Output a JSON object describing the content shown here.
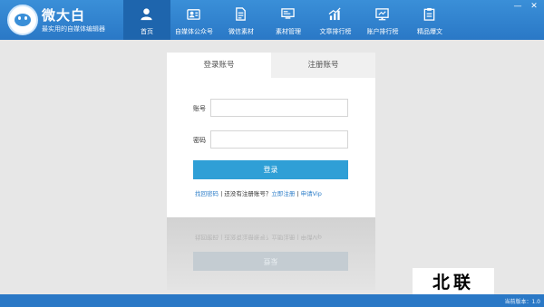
{
  "app": {
    "title": "微大白",
    "subtitle": "最实用的自媒体编辑器"
  },
  "nav": {
    "items": [
      {
        "label": "首页",
        "icon": "user-icon"
      },
      {
        "label": "自媒体公众号",
        "icon": "media-account-icon"
      },
      {
        "label": "微信素材",
        "icon": "document-icon"
      },
      {
        "label": "素材管理",
        "icon": "monitor-icon"
      },
      {
        "label": "文章排行榜",
        "icon": "chart-icon"
      },
      {
        "label": "账户排行榜",
        "icon": "screen-icon"
      },
      {
        "label": "精品爆文",
        "icon": "clipboard-icon"
      }
    ]
  },
  "window": {
    "minimize": "—",
    "close": "✕"
  },
  "login": {
    "tab_login": "登录账号",
    "tab_register": "注册账号",
    "account_label": "账号",
    "password_label": "密码",
    "account_value": "",
    "password_value": "",
    "login_button": "登录",
    "link_forgot": "找回密码",
    "sep1": " | ",
    "text_no_account": "还没有注册账号？",
    "link_register": "立即注册",
    "sep2": " | ",
    "link_vip": "申请Vip"
  },
  "watermark": "北联",
  "status": {
    "version": "当前版本：1.0"
  },
  "colors": {
    "header": "#2a78c6",
    "active_nav": "#1e65ad",
    "button": "#2f9fd6",
    "link": "#2f7fc9"
  }
}
